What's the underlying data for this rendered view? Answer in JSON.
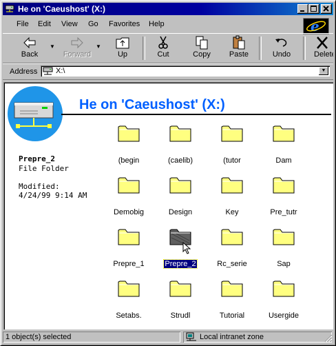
{
  "window": {
    "title": "He on 'Caeushost' (X:)",
    "buttons": [
      "minimize",
      "maximize",
      "close"
    ]
  },
  "menu": [
    {
      "label": "File"
    },
    {
      "label": "Edit"
    },
    {
      "label": "View"
    },
    {
      "label": "Go"
    },
    {
      "label": "Favorites"
    },
    {
      "label": "Help"
    }
  ],
  "toolbar": {
    "back": "Back",
    "forward": "Forward",
    "up": "Up",
    "cut": "Cut",
    "copy": "Copy",
    "paste": "Paste",
    "undo": "Undo",
    "delete": "Delete"
  },
  "address": {
    "label": "Address",
    "value": "X:\\"
  },
  "content": {
    "heading": "He on 'Caeushost' (X:)",
    "details": {
      "name": "Prepre_2",
      "type": "File Folder",
      "modified_label": "Modified:",
      "modified_value": "4/24/99 9:14 AM"
    },
    "folders": [
      {
        "name": "(begin"
      },
      {
        "name": "(caelib)"
      },
      {
        "name": "(tutor"
      },
      {
        "name": "Dam"
      },
      {
        "name": "Demobig"
      },
      {
        "name": "Design"
      },
      {
        "name": "Key"
      },
      {
        "name": "Pre_tutr"
      },
      {
        "name": "Prepre_1"
      },
      {
        "name": "Prepre_2",
        "selected": true
      },
      {
        "name": "Rc_serie"
      },
      {
        "name": "Sap"
      },
      {
        "name": "Setabs."
      },
      {
        "name": "Strudl"
      },
      {
        "name": "Tutorial"
      },
      {
        "name": "Usergide"
      }
    ]
  },
  "status": {
    "left": "1 object(s) selected",
    "zone": "Local intranet zone"
  },
  "colors": {
    "title_bar": "#000080",
    "heading": "#0060ff",
    "folder": "#ffff80",
    "selection": "#000080"
  }
}
